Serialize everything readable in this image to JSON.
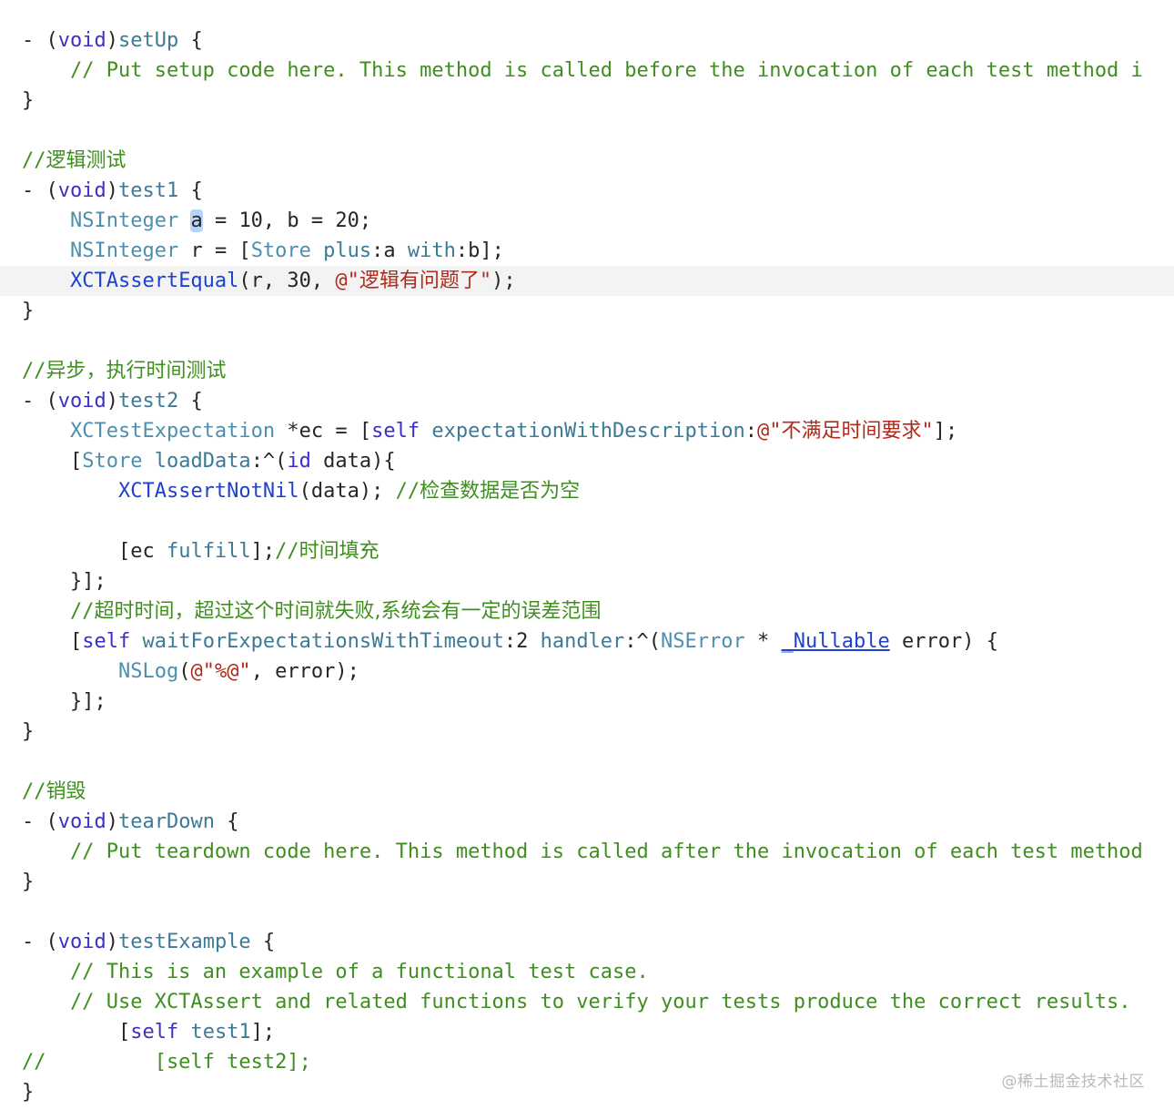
{
  "editor": {
    "lines": [
      [
        {
          "t": "- (",
          "c": "plain"
        },
        {
          "t": "void",
          "c": "keyword"
        },
        {
          "t": ")",
          "c": "plain"
        },
        {
          "t": "setUp",
          "c": "method"
        },
        {
          "t": " {",
          "c": "plain"
        }
      ],
      [
        {
          "t": "    // Put setup code here. This method is called before the invocation of each test method i",
          "c": "comment"
        }
      ],
      [
        {
          "t": "}",
          "c": "plain"
        }
      ],
      [],
      [
        {
          "t": "//",
          "c": "comment"
        },
        {
          "t": "逻辑测试",
          "c": "comment",
          "cjk": true
        }
      ],
      [
        {
          "t": "- (",
          "c": "plain"
        },
        {
          "t": "void",
          "c": "keyword"
        },
        {
          "t": ")",
          "c": "plain"
        },
        {
          "t": "test1",
          "c": "method"
        },
        {
          "t": " {",
          "c": "plain"
        }
      ],
      [
        {
          "t": "    ",
          "c": "plain"
        },
        {
          "t": "NSInteger",
          "c": "type"
        },
        {
          "t": " ",
          "c": "plain"
        },
        {
          "t": "a",
          "c": "plain",
          "sel": true
        },
        {
          "t": " = 10, b = 20;",
          "c": "plain"
        }
      ],
      [
        {
          "t": "    ",
          "c": "plain"
        },
        {
          "t": "NSInteger",
          "c": "type"
        },
        {
          "t": " r = [",
          "c": "plain"
        },
        {
          "t": "Store",
          "c": "type"
        },
        {
          "t": " ",
          "c": "plain"
        },
        {
          "t": "plus",
          "c": "method"
        },
        {
          "t": ":a ",
          "c": "plain"
        },
        {
          "t": "with",
          "c": "method"
        },
        {
          "t": ":b];",
          "c": "plain"
        }
      ],
      [
        {
          "t": "    ",
          "c": "plain"
        },
        {
          "t": "XCTAssertEqual",
          "c": "macro"
        },
        {
          "t": "(r, 30, ",
          "c": "plain"
        },
        {
          "t": "@\"",
          "c": "string"
        },
        {
          "t": "逻辑有问题了",
          "c": "string",
          "cjk": true
        },
        {
          "t": "\"",
          "c": "string"
        },
        {
          "t": ");",
          "c": "plain"
        }
      ],
      [
        {
          "t": "}",
          "c": "plain"
        }
      ],
      [],
      [
        {
          "t": "//",
          "c": "comment"
        },
        {
          "t": "异步，执行时间测试",
          "c": "comment",
          "cjk": true
        }
      ],
      [
        {
          "t": "- (",
          "c": "plain"
        },
        {
          "t": "void",
          "c": "keyword"
        },
        {
          "t": ")",
          "c": "plain"
        },
        {
          "t": "test2",
          "c": "method"
        },
        {
          "t": " {",
          "c": "plain"
        }
      ],
      [
        {
          "t": "    ",
          "c": "plain"
        },
        {
          "t": "XCTestExpectation",
          "c": "type"
        },
        {
          "t": " *ec = [",
          "c": "plain"
        },
        {
          "t": "self",
          "c": "keyword"
        },
        {
          "t": " ",
          "c": "plain"
        },
        {
          "t": "expectationWithDescription",
          "c": "method"
        },
        {
          "t": ":",
          "c": "plain"
        },
        {
          "t": "@\"",
          "c": "string"
        },
        {
          "t": "不满足时间要求",
          "c": "string",
          "cjk": true
        },
        {
          "t": "\"",
          "c": "string"
        },
        {
          "t": "];",
          "c": "plain"
        }
      ],
      [
        {
          "t": "    [",
          "c": "plain"
        },
        {
          "t": "Store",
          "c": "type"
        },
        {
          "t": " ",
          "c": "plain"
        },
        {
          "t": "loadData",
          "c": "method"
        },
        {
          "t": ":^(",
          "c": "plain"
        },
        {
          "t": "id",
          "c": "keyword"
        },
        {
          "t": " data){",
          "c": "plain"
        }
      ],
      [
        {
          "t": "        ",
          "c": "plain"
        },
        {
          "t": "XCTAssertNotNil",
          "c": "macro"
        },
        {
          "t": "(data); ",
          "c": "plain"
        },
        {
          "t": "//",
          "c": "comment"
        },
        {
          "t": "检查数据是否为空",
          "c": "comment",
          "cjk": true
        }
      ],
      [],
      [
        {
          "t": "        [ec ",
          "c": "plain"
        },
        {
          "t": "fulfill",
          "c": "method"
        },
        {
          "t": "];",
          "c": "plain"
        },
        {
          "t": "//",
          "c": "comment"
        },
        {
          "t": "时间填充",
          "c": "comment",
          "cjk": true
        }
      ],
      [
        {
          "t": "    }];",
          "c": "plain"
        }
      ],
      [
        {
          "t": "    //",
          "c": "comment"
        },
        {
          "t": "超时时间，超过这个时间就失败,系统会有一定的误差范围",
          "c": "comment",
          "cjk": true
        }
      ],
      [
        {
          "t": "    [",
          "c": "plain"
        },
        {
          "t": "self",
          "c": "keyword"
        },
        {
          "t": " ",
          "c": "plain"
        },
        {
          "t": "waitForExpectationsWithTimeout",
          "c": "method"
        },
        {
          "t": ":2 ",
          "c": "plain"
        },
        {
          "t": "handler",
          "c": "method"
        },
        {
          "t": ":^(",
          "c": "plain"
        },
        {
          "t": "NSError",
          "c": "type"
        },
        {
          "t": " * ",
          "c": "plain"
        },
        {
          "t": "_Nullable",
          "c": "macro",
          "ul": true
        },
        {
          "t": " error) {",
          "c": "plain"
        }
      ],
      [
        {
          "t": "        ",
          "c": "plain"
        },
        {
          "t": "NSLog",
          "c": "type"
        },
        {
          "t": "(",
          "c": "plain"
        },
        {
          "t": "@\"%@\"",
          "c": "string"
        },
        {
          "t": ", error);",
          "c": "plain"
        }
      ],
      [
        {
          "t": "    }];",
          "c": "plain"
        }
      ],
      [
        {
          "t": "}",
          "c": "plain"
        }
      ],
      [],
      [
        {
          "t": "//",
          "c": "comment"
        },
        {
          "t": "销毁",
          "c": "comment",
          "cjk": true
        }
      ],
      [
        {
          "t": "- (",
          "c": "plain"
        },
        {
          "t": "void",
          "c": "keyword"
        },
        {
          "t": ")",
          "c": "plain"
        },
        {
          "t": "tearDown",
          "c": "method"
        },
        {
          "t": " {",
          "c": "plain"
        }
      ],
      [
        {
          "t": "    // Put teardown code here. This method is called after the invocation of each test method",
          "c": "comment"
        }
      ],
      [
        {
          "t": "}",
          "c": "plain"
        }
      ],
      [],
      [
        {
          "t": "- (",
          "c": "plain"
        },
        {
          "t": "void",
          "c": "keyword"
        },
        {
          "t": ")",
          "c": "plain"
        },
        {
          "t": "testExample",
          "c": "method"
        },
        {
          "t": " {",
          "c": "plain"
        }
      ],
      [
        {
          "t": "    // This is an example of a functional test case.",
          "c": "comment"
        }
      ],
      [
        {
          "t": "    // Use XCTAssert and related functions to verify your tests produce the correct results.",
          "c": "comment"
        }
      ],
      [
        {
          "t": "        [",
          "c": "plain"
        },
        {
          "t": "self",
          "c": "keyword"
        },
        {
          "t": " ",
          "c": "plain"
        },
        {
          "t": "test1",
          "c": "method"
        },
        {
          "t": "];",
          "c": "plain"
        }
      ],
      [
        {
          "t": "//         [self test2];",
          "c": "comment"
        }
      ],
      [
        {
          "t": "}",
          "c": "plain"
        }
      ]
    ],
    "current_line_index": 8
  },
  "watermark": "@稀土掘金技术社区",
  "colors": {
    "keyword": "#3c2fc8",
    "type": "#4d8fae",
    "method": "#3d7a96",
    "macro": "#1f41cf",
    "string": "#b1291b",
    "comment": "#3f8f1f",
    "plain": "#262626",
    "selection": "#b7d2fb",
    "current_line": "#f3f3f3"
  }
}
